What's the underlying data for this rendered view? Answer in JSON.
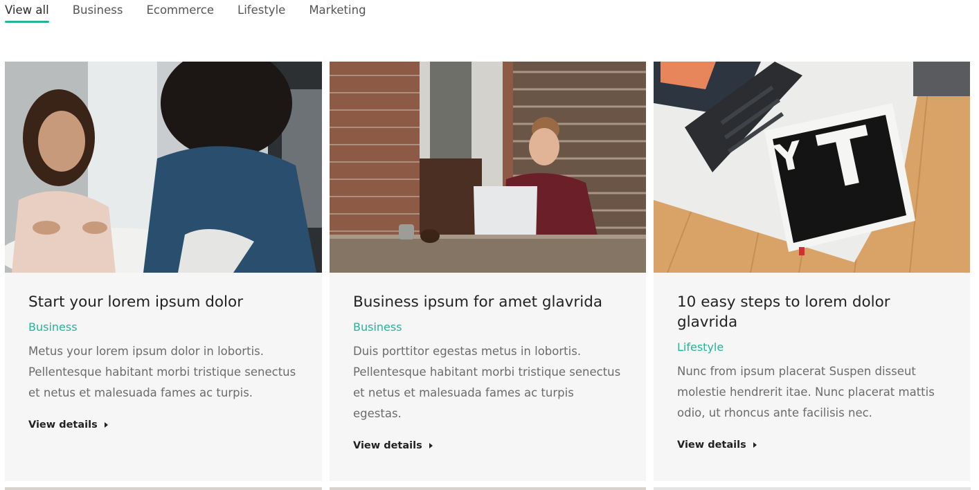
{
  "tabs": [
    {
      "label": "View all",
      "active": true
    },
    {
      "label": "Business",
      "active": false
    },
    {
      "label": "Ecommerce",
      "active": false
    },
    {
      "label": "Lifestyle",
      "active": false
    },
    {
      "label": "Marketing",
      "active": false
    }
  ],
  "accent_color": "#23b59b",
  "cards": [
    {
      "image": "two-women-meeting-photo",
      "title": "Start your lorem ipsum dolor",
      "category": "Business",
      "description": "Metus your lorem ipsum dolor in lobortis. Pellentesque habitant morbi tristique senectus et netus et malesuada fames ac turpis.",
      "link": "View details"
    },
    {
      "image": "woman-laptop-brick-wall-photo",
      "title": "Business ipsum for amet glavrida",
      "category": "Business",
      "description": "Duis porttitor egestas metus in lobortis. Pellentesque habitant morbi tristique senectus et netus et malesuada fames ac turpis egestas.",
      "link": "View details"
    },
    {
      "image": "typography-book-keyboard-photo",
      "title": "10 easy steps to lorem dolor glavrida",
      "category": "Lifestyle",
      "description": "Nunc from ipsum placerat Suspen disseut molestie hendrerit itae. Nunc placerat mattis odio, ut rhoncus ante facilisis nec.",
      "link": "View details"
    }
  ]
}
